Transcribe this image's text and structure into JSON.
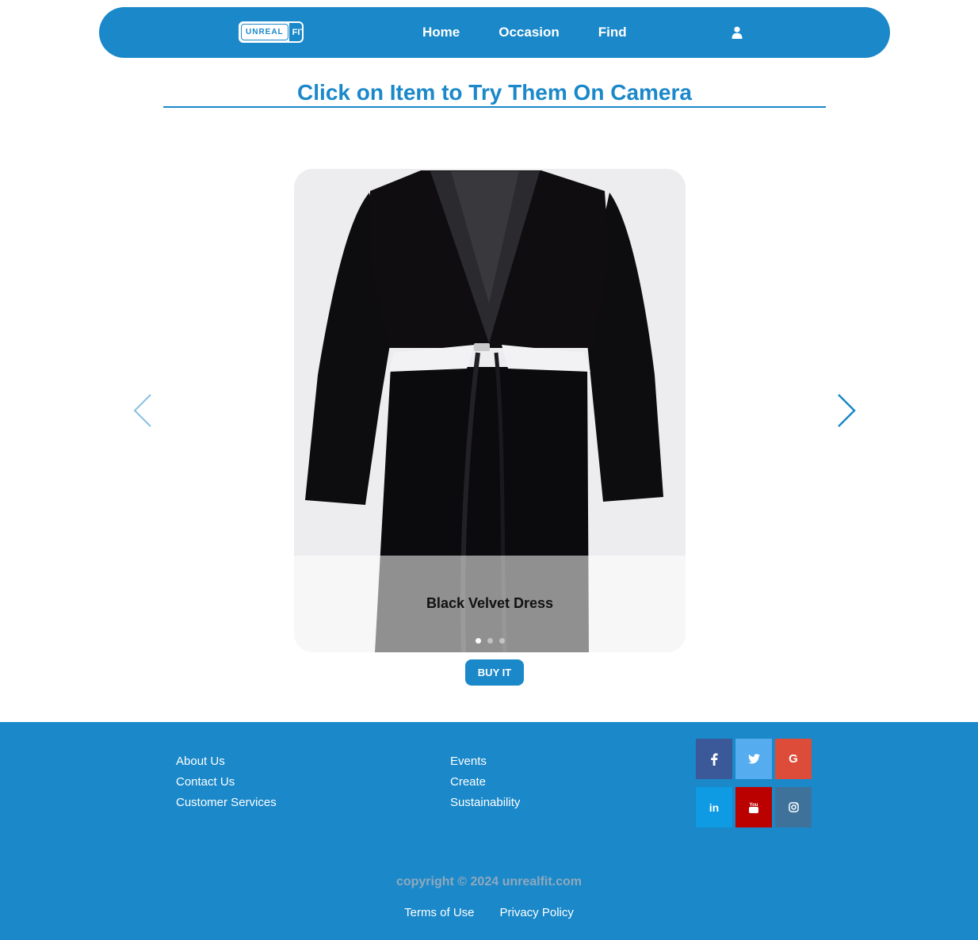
{
  "brand": {
    "logo_left": "UNREAL",
    "logo_right": "FIT"
  },
  "nav": {
    "items": [
      "Home",
      "Occasion",
      "Find"
    ],
    "user_icon": "user-icon"
  },
  "page": {
    "title": "Click on Item to Try Them On Camera"
  },
  "carousel": {
    "caption": "Black Velvet Dress",
    "slide_count": 3,
    "active_index": 0,
    "prev_icon": "chevron-left-icon",
    "next_icon": "chevron-right-icon"
  },
  "buy_button": {
    "label": "BUY IT"
  },
  "footer": {
    "col1": [
      "About Us",
      "Contact Us",
      "Customer Services"
    ],
    "col2": [
      "Events",
      "Create",
      "Sustainability"
    ],
    "social": [
      {
        "name": "facebook-icon",
        "glyph": "f",
        "color": "#3b5998"
      },
      {
        "name": "twitter-icon",
        "glyph": "t",
        "color": "#55acee"
      },
      {
        "name": "google-icon",
        "glyph": "G",
        "color": "#dd4b39"
      },
      {
        "name": "linkedin-icon",
        "glyph": "in",
        "color": "#0e9be3"
      },
      {
        "name": "youtube-icon",
        "glyph": "yt",
        "color": "#bb0000"
      },
      {
        "name": "instagram-icon",
        "glyph": "ig",
        "color": "#3f729b"
      }
    ],
    "copyright": "copyright © 2024 unrealfit.com",
    "legal": [
      "Terms of Use",
      "Privacy Policy"
    ]
  },
  "colors": {
    "primary": "#1a88c9"
  }
}
